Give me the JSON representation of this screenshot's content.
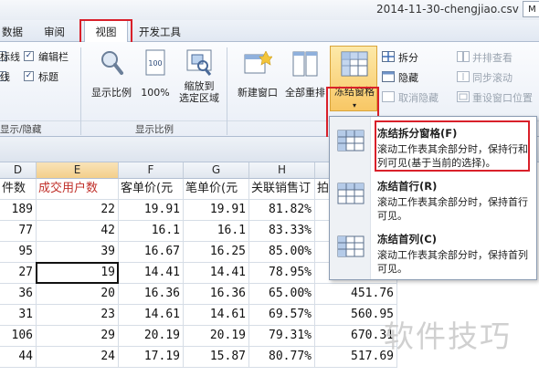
{
  "title_bar": {
    "filename": "2014-11-30-chengjiao.csv -",
    "window_button": "M"
  },
  "tabs": [
    "数据",
    "审阅",
    "视图",
    "开发工具"
  ],
  "ribbon": {
    "show_hide": {
      "label": "显示/隐藏",
      "items": [
        {
          "label": "标线",
          "checked": false
        },
        {
          "label": "编辑栏",
          "checked": true
        },
        {
          "label": "线",
          "checked": true
        },
        {
          "label": "标题",
          "checked": true
        }
      ]
    },
    "zoom": {
      "label": "显示比例",
      "buttons": [
        "显示比例",
        "100%",
        "缩放到\n选定区域"
      ]
    },
    "window": {
      "new_window": "新建窗口",
      "arrange_all": "全部重排",
      "freeze_panes": "冻结窗格",
      "split": "拆分",
      "hide": "隐藏",
      "unhide": "取消隐藏",
      "side_by_side": "并排查看",
      "sync_scroll": "同步滚动",
      "reset_position": "重设窗口位置"
    }
  },
  "freeze_menu": [
    {
      "title": "冻结拆分窗格(F)",
      "desc": "滚动工作表其余部分时，保持行和列可见(基于当前的选择)。"
    },
    {
      "title": "冻结首行(R)",
      "desc": "滚动工作表其余部分时，保持首行可见。"
    },
    {
      "title": "冻结首列(C)",
      "desc": "滚动工作表其余部分时，保持首列可见。"
    }
  ],
  "sheet": {
    "columns": [
      "D",
      "E",
      "F",
      "G",
      "H",
      ""
    ],
    "header_row": [
      "件数",
      "成交用户数",
      "客单价(元",
      "笔单价(元",
      "关联销售订",
      "拍"
    ],
    "rows": [
      [
        "189",
        "22",
        "19.91",
        "19.91",
        "81.82%",
        ""
      ],
      [
        "77",
        "42",
        "16.1",
        "16.1",
        "83.33%",
        ""
      ],
      [
        "95",
        "39",
        "16.67",
        "16.25",
        "85.00%",
        ""
      ],
      [
        "27",
        "19",
        "14.41",
        "14.41",
        "78.95%",
        ""
      ],
      [
        "36",
        "20",
        "16.36",
        "16.36",
        "65.00%",
        "451.76"
      ],
      [
        "31",
        "23",
        "14.61",
        "14.61",
        "69.57%",
        "560.95"
      ],
      [
        "106",
        "29",
        "20.19",
        "20.19",
        "79.31%",
        "670.31"
      ],
      [
        "44",
        "24",
        "17.19",
        "15.87",
        "80.77%",
        "517.69"
      ]
    ],
    "active_value": "19"
  },
  "watermark": "软件技巧",
  "colors": {
    "highlight_red": "#d9202a",
    "header_red": "#c0302a"
  }
}
